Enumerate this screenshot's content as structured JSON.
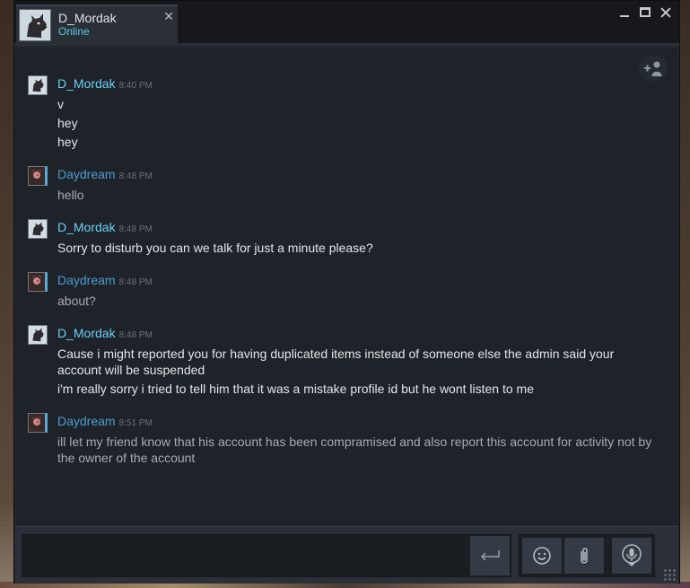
{
  "window": {
    "tab": {
      "name": "D_Mordak",
      "status": "Online"
    }
  },
  "colors": {
    "accent_online": "#57cbde",
    "mordak_name": "#6dcff6",
    "daydream_name": "#4b9fd0",
    "background": "#1e2229"
  },
  "messages": [
    {
      "sender": "D_Mordak",
      "time": "8:40 PM",
      "lines": [
        "v",
        "hey",
        "hey"
      ]
    },
    {
      "sender": "Daydream",
      "time": "8:48 PM",
      "lines": [
        "hello"
      ]
    },
    {
      "sender": "D_Mordak",
      "time": "8:48 PM",
      "lines": [
        "Sorry to disturb you can we talk for just a minute please?"
      ]
    },
    {
      "sender": "Daydream",
      "time": "8:48 PM",
      "lines": [
        "about?"
      ]
    },
    {
      "sender": "D_Mordak",
      "time": "8:48 PM",
      "lines": [
        "Cause i might reported you for having duplicated items instead of someone else the admin said your account will be suspended",
        "i'm really sorry i tried to tell him that it was a mistake profile id but he wont listen to me"
      ]
    },
    {
      "sender": "Daydream",
      "time": "8:51 PM",
      "lines": [
        "ill let my friend know that his account has been compramised and also report this account for activity not by the owner of the account"
      ]
    }
  ],
  "input": {
    "value": "",
    "placeholder": ""
  },
  "icons": {
    "send": "enter-arrow-icon",
    "emoticon": "smiley-icon",
    "attach": "paperclip-icon",
    "voice": "microphone-icon",
    "add_friend": "add-user-icon"
  }
}
